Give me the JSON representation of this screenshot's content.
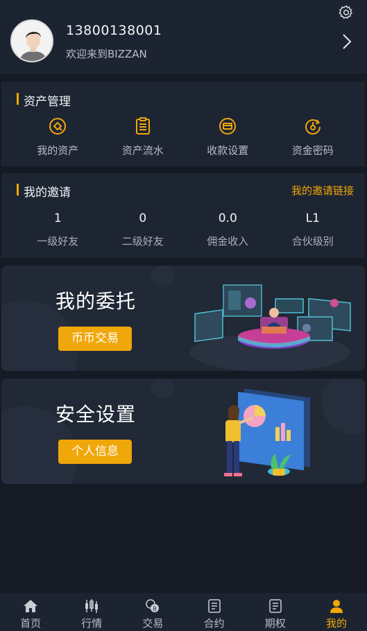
{
  "profile": {
    "phone": "13800138001",
    "welcome": "欢迎来到BIZZAN"
  },
  "asset_section": {
    "title": "资产管理",
    "items": [
      {
        "label": "我的资产",
        "icon": "asset-icon"
      },
      {
        "label": "资产流水",
        "icon": "ledger-icon"
      },
      {
        "label": "收款设置",
        "icon": "card-icon"
      },
      {
        "label": "资金密码",
        "icon": "password-icon"
      }
    ]
  },
  "invite_section": {
    "title": "我的邀请",
    "link_label": "我的邀请链接",
    "stats": [
      {
        "value": "1",
        "label": "一级好友"
      },
      {
        "value": "0",
        "label": "二级好友"
      },
      {
        "value": "0.0",
        "label": "佣金收入"
      },
      {
        "value": "L1",
        "label": "合伙级别"
      }
    ]
  },
  "banners": [
    {
      "title": "我的委托",
      "button": "币币交易"
    },
    {
      "title": "安全设置",
      "button": "个人信息"
    }
  ],
  "bottom_nav": [
    {
      "label": "首页",
      "icon": "home-icon"
    },
    {
      "label": "行情",
      "icon": "candlestick-icon"
    },
    {
      "label": "交易",
      "icon": "exchange-icon"
    },
    {
      "label": "合约",
      "icon": "contract-icon"
    },
    {
      "label": "期权",
      "icon": "option-icon"
    },
    {
      "label": "我的",
      "icon": "user-icon",
      "active": true
    }
  ],
  "colors": {
    "accent": "#f0a70a",
    "background": "#151a25",
    "card": "#1e2532"
  }
}
